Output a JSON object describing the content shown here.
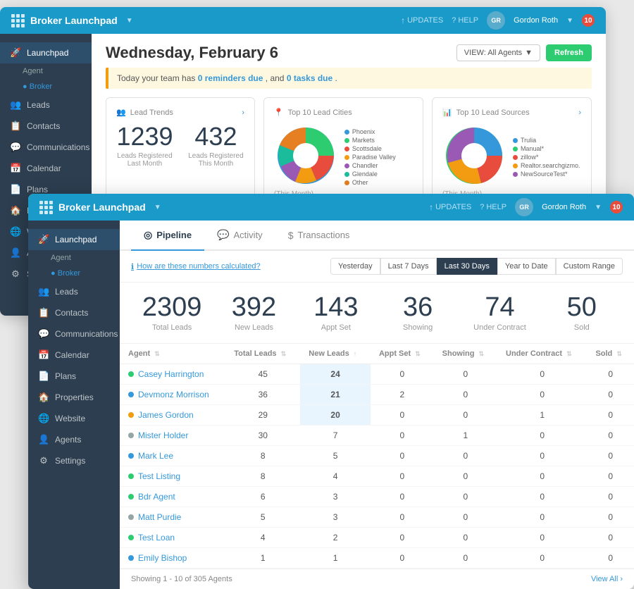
{
  "back_window": {
    "header": {
      "title": "Broker Launchpad",
      "updates_label": "UPDATES",
      "help_label": "HELP",
      "user_name": "Gordon Roth",
      "notif_count": "10"
    },
    "main": {
      "date": "Wednesday, February 6",
      "view_btn": "VIEW: All Agents",
      "refresh_btn": "Refresh",
      "alert": "Today your team has ",
      "alert_reminders": "0 reminders due",
      "alert_mid": ", and ",
      "alert_tasks": "0 tasks due",
      "alert_end": ".",
      "cards": {
        "lead_trends": {
          "title": "Lead Trends",
          "stat1_num": "1239",
          "stat1_label": "Leads Registered Last Month",
          "stat2_num": "432",
          "stat2_label": "Leads Registered This Month"
        },
        "top_cities": {
          "title": "Top 10 Lead Cities",
          "subtitle": "(This Month)",
          "legend": [
            {
              "label": "Phoenix",
              "color": "#3498db"
            },
            {
              "label": "Markets",
              "color": "#2ecc71"
            },
            {
              "label": "Scottsdale",
              "color": "#e74c3c"
            },
            {
              "label": "Paradise Valley",
              "color": "#f39c12"
            },
            {
              "label": "Chandler",
              "color": "#9b59b6"
            },
            {
              "label": "Glendale",
              "color": "#1abc9c"
            },
            {
              "label": "Other",
              "color": "#e67e22"
            }
          ]
        },
        "top_sources": {
          "title": "Top 10 Lead Sources",
          "subtitle": "(This Month)",
          "legend": [
            {
              "label": "Trulia",
              "color": "#3498db"
            },
            {
              "label": "Manual*",
              "color": "#2ecc71"
            },
            {
              "label": "Zillow*",
              "color": "#e74c3c"
            },
            {
              "label": "Realtor.searchgizmo.",
              "color": "#f39c12"
            },
            {
              "label": "NewSourceTest*",
              "color": "#9b59b6"
            }
          ]
        }
      }
    },
    "sidebar": {
      "items": [
        {
          "label": "Launchpad",
          "icon": "🚀"
        },
        {
          "label": "Agent",
          "sub": true
        },
        {
          "label": "Broker",
          "sub": true,
          "active": true
        },
        {
          "label": "Leads",
          "icon": "👥"
        },
        {
          "label": "Contacts",
          "icon": "📋"
        },
        {
          "label": "Communications",
          "icon": "💬"
        },
        {
          "label": "Calendar",
          "icon": "📅"
        },
        {
          "label": "Plans",
          "icon": "📄"
        },
        {
          "label": "Properties",
          "icon": "🏠"
        },
        {
          "label": "Website",
          "icon": "🌐"
        },
        {
          "label": "Agents",
          "icon": "👤"
        },
        {
          "label": "Settings",
          "icon": "⚙"
        }
      ]
    }
  },
  "front_window": {
    "header": {
      "title": "Broker Launchpad",
      "updates_label": "UPDATES",
      "help_label": "HELP",
      "user_name": "Gordon Roth",
      "notif_count": "10"
    },
    "tabs": [
      {
        "label": "Pipeline",
        "icon": "◎",
        "active": true
      },
      {
        "label": "Activity",
        "icon": "💬"
      },
      {
        "label": "Transactions",
        "icon": "$"
      }
    ],
    "filter_link": "How are these numbers calculated?",
    "date_filters": [
      {
        "label": "Yesterday"
      },
      {
        "label": "Last 7 Days"
      },
      {
        "label": "Last 30 Days",
        "active": true
      },
      {
        "label": "Year to Date"
      },
      {
        "label": "Custom Range"
      }
    ],
    "stats": [
      {
        "num": "2309",
        "label": "Total Leads"
      },
      {
        "num": "392",
        "label": "New Leads"
      },
      {
        "num": "143",
        "label": "Appt Set"
      },
      {
        "num": "36",
        "label": "Showing"
      },
      {
        "num": "74",
        "label": "Under Contract"
      },
      {
        "num": "50",
        "label": "Sold"
      }
    ],
    "table": {
      "headers": [
        {
          "label": "Agent",
          "sortable": true
        },
        {
          "label": "Total Leads",
          "sortable": true
        },
        {
          "label": "New Leads",
          "sortable": true
        },
        {
          "label": "Appt Set",
          "sortable": true
        },
        {
          "label": "Showing",
          "sortable": true
        },
        {
          "label": "Under Contract",
          "sortable": true
        },
        {
          "label": "Sold",
          "sortable": true
        }
      ],
      "rows": [
        {
          "agent": "Casey Harrington",
          "color": "#2ecc71",
          "total": "45",
          "new": "24",
          "appt": "0",
          "showing": "0",
          "contract": "0",
          "sold": "0"
        },
        {
          "agent": "Devmonz Morrison",
          "color": "#3498db",
          "total": "36",
          "new": "21",
          "appt": "2",
          "showing": "0",
          "contract": "0",
          "sold": "0"
        },
        {
          "agent": "James Gordon",
          "color": "#f39c12",
          "total": "29",
          "new": "20",
          "appt": "0",
          "showing": "0",
          "contract": "1",
          "sold": "0"
        },
        {
          "agent": "Mister Holder",
          "color": "#95a5a6",
          "total": "30",
          "new": "7",
          "appt": "0",
          "showing": "1",
          "contract": "0",
          "sold": "0"
        },
        {
          "agent": "Mark Lee",
          "color": "#3498db",
          "total": "8",
          "new": "5",
          "appt": "0",
          "showing": "0",
          "contract": "0",
          "sold": "0"
        },
        {
          "agent": "Test Listing",
          "color": "#2ecc71",
          "total": "8",
          "new": "4",
          "appt": "0",
          "showing": "0",
          "contract": "0",
          "sold": "0"
        },
        {
          "agent": "Bdr Agent",
          "color": "#2ecc71",
          "total": "6",
          "new": "3",
          "appt": "0",
          "showing": "0",
          "contract": "0",
          "sold": "0"
        },
        {
          "agent": "Matt Purdie",
          "color": "#95a5a6",
          "total": "5",
          "new": "3",
          "appt": "0",
          "showing": "0",
          "contract": "0",
          "sold": "0"
        },
        {
          "agent": "Test Loan",
          "color": "#2ecc71",
          "total": "4",
          "new": "2",
          "appt": "0",
          "showing": "0",
          "contract": "0",
          "sold": "0"
        },
        {
          "agent": "Emily Bishop",
          "color": "#3498db",
          "total": "1",
          "new": "1",
          "appt": "0",
          "showing": "0",
          "contract": "0",
          "sold": "0"
        }
      ],
      "footer_showing": "Showing 1 - 10 of 305 Agents",
      "view_all": "View All ›"
    },
    "sidebar": {
      "items": [
        {
          "label": "Launchpad",
          "icon": "🚀"
        },
        {
          "label": "Agent",
          "sub": true
        },
        {
          "label": "Broker",
          "sub": true,
          "active": true
        },
        {
          "label": "Leads",
          "icon": "👥"
        },
        {
          "label": "Contacts",
          "icon": "📋"
        },
        {
          "label": "Communications",
          "icon": "💬"
        },
        {
          "label": "Calendar",
          "icon": "📅"
        },
        {
          "label": "Plans",
          "icon": "📄"
        },
        {
          "label": "Properties",
          "icon": "🏠"
        },
        {
          "label": "Website",
          "icon": "🌐"
        },
        {
          "label": "Agents",
          "icon": "👤"
        },
        {
          "label": "Settings",
          "icon": "⚙"
        }
      ]
    }
  }
}
